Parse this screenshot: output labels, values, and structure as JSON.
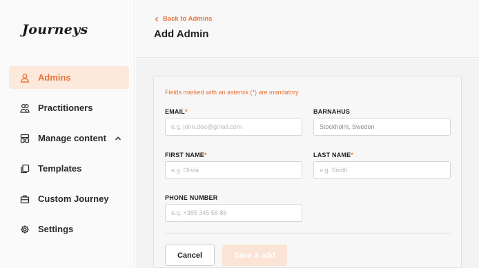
{
  "brand": {
    "logo_text": "Journeys",
    "accent": "#e8733a"
  },
  "sidebar": {
    "items": [
      {
        "label": "Admins",
        "icon": "user-icon",
        "active": true
      },
      {
        "label": "Practitioners",
        "icon": "users-icon"
      },
      {
        "label": "Manage content",
        "icon": "layout-icon",
        "expanded": true
      },
      {
        "label": "Templates",
        "icon": "copy-icon"
      },
      {
        "label": "Custom Journey",
        "icon": "briefcase-icon"
      },
      {
        "label": "Settings",
        "icon": "gear-icon"
      }
    ]
  },
  "header": {
    "back_label": "Back to Admins",
    "title": "Add Admin"
  },
  "form": {
    "mandatory_note": "Fields marked with an asterisk (*) are mandatory",
    "email": {
      "label": "EMAIL",
      "placeholder": "e.g. john.doe@gmail.com",
      "required_mark": "*"
    },
    "barnahus": {
      "label": "BARNAHUS",
      "value": "Stockholm, Sweden"
    },
    "first_name": {
      "label": "FIRST NAME",
      "placeholder": "e.g. Olivia",
      "required_mark": "*"
    },
    "last_name": {
      "label": "LAST NAME",
      "placeholder": "e.g. Smith",
      "required_mark": "*"
    },
    "phone": {
      "label": "PHONE NUMBER",
      "placeholder": "e.g. +385 345 56 86"
    }
  },
  "actions": {
    "cancel_label": "Cancel",
    "save_label": "Save & add"
  }
}
